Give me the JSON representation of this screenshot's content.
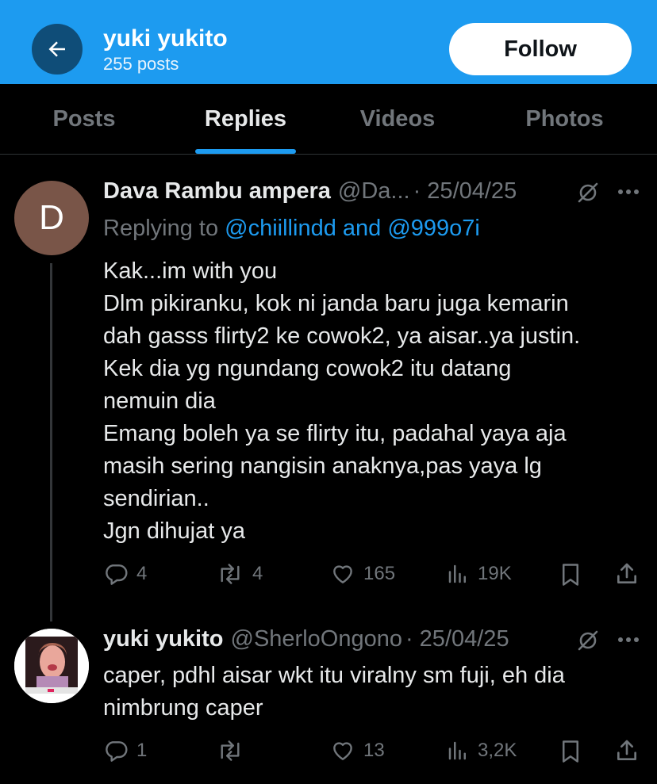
{
  "header": {
    "name": "yuki yukito",
    "post_count": "255 posts",
    "follow_label": "Follow"
  },
  "tabs": [
    {
      "label": "Posts"
    },
    {
      "label": "Replies"
    },
    {
      "label": "Videos"
    },
    {
      "label": "Photos"
    }
  ],
  "active_tab": "Replies",
  "posts": [
    {
      "avatar_letter": "D",
      "name": "Dava Rambu ampera",
      "handle": "@Da...",
      "date": "· 25/04/25",
      "replying_prefix": "Replying to",
      "replying_mentions": "@chiillindd and @999o7i",
      "lines": [
        "Kak...im with you",
        "Dlm pikiranku, kok ni janda baru juga kemarin",
        "dah gasss flirty2 ke cowok2, ya aisar..ya justin.",
        "Kek dia yg ngundang cowok2 itu datang",
        "nemuin dia",
        "Emang boleh ya se flirty itu, padahal yaya aja",
        "masih sering nangisin anaknya,pas yaya lg",
        "sendirian..",
        "Jgn dihujat ya"
      ],
      "replies": "4",
      "reposts": "4",
      "likes": "165",
      "views": "19K"
    },
    {
      "name": "yuki yukito",
      "handle": "@SherloOngono",
      "date": "· 25/04/25",
      "lines": [
        "caper, pdhl aisar wkt itu viralny sm fuji, eh dia",
        "nimbrung caper"
      ],
      "replies": "1",
      "reposts": "",
      "likes": "13",
      "views": "3,2K"
    }
  ],
  "colors": {
    "accent": "#1d9bf0",
    "background": "#000000",
    "text": "#e7e9ea",
    "muted": "#71767b",
    "avatar_d": "#795548"
  },
  "icons": [
    "back-arrow-icon",
    "grok-icon",
    "more-icon",
    "reply-icon",
    "repost-icon",
    "like-icon",
    "views-icon",
    "bookmark-icon",
    "share-icon"
  ]
}
